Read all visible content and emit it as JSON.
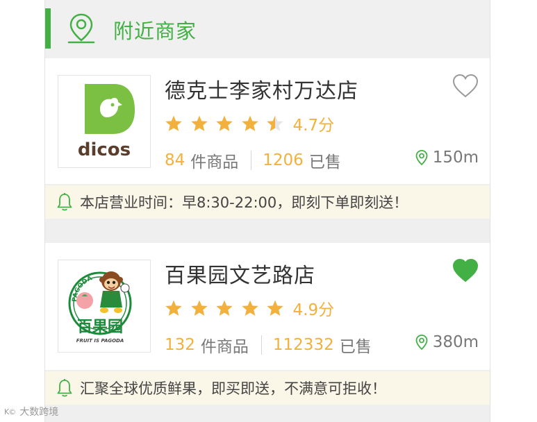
{
  "section": {
    "title": "附近商家",
    "icon": "map-pin-icon",
    "accent": "#43b046"
  },
  "stores": [
    {
      "name": "德克士李家村万达店",
      "logo_text": "dicos",
      "rating": 4.7,
      "rating_text": "4.7分",
      "product_count": "84",
      "product_unit": "件商品",
      "sold_count": "1206",
      "sold_unit": "已售",
      "distance": "150m",
      "favorited": false,
      "notice": "本店营业时间：早8:30-22:00，即刻下单即刻送！"
    },
    {
      "name": "百果园文艺路店",
      "logo_text": "百果园",
      "logo_arc": "PAGODA",
      "logo_tagline": "FRUIT IS PAGODA",
      "rating": 4.9,
      "rating_text": "4.9分",
      "product_count": "132",
      "product_unit": "件商品",
      "sold_count": "112332",
      "sold_unit": "已售",
      "distance": "380m",
      "favorited": true,
      "notice": "汇聚全球优质鲜果，即买即送，不满意可拒收！"
    }
  ],
  "colors": {
    "star": "#f1b13c",
    "heart": "#43b046",
    "notice_bg": "#faf6e8"
  },
  "watermark": {
    "text": "大数跨境",
    "mark": "K©"
  }
}
